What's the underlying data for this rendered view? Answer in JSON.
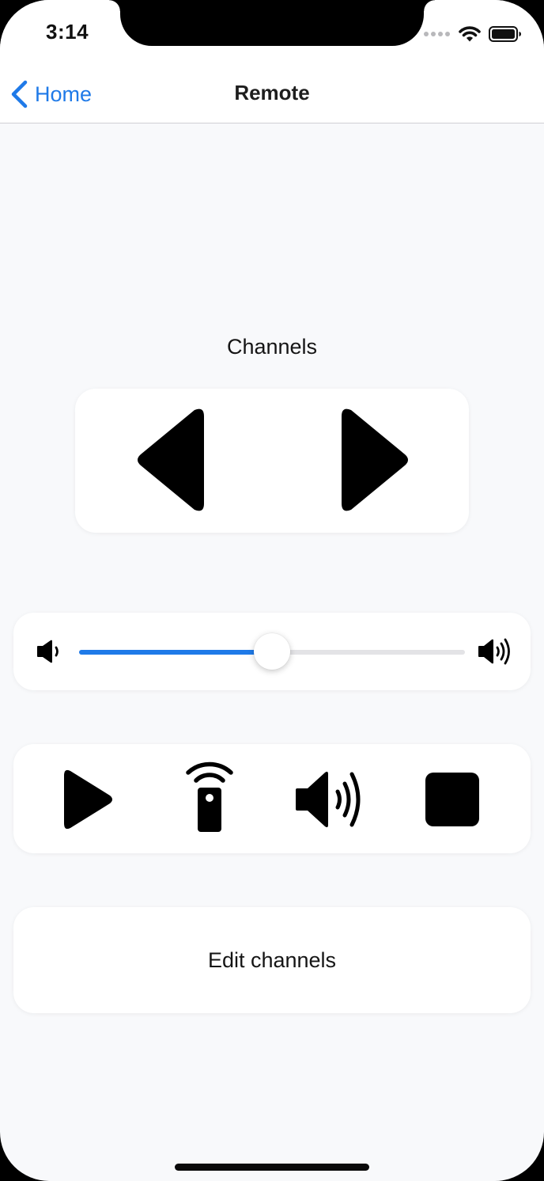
{
  "status_bar": {
    "time": "3:14",
    "icons": [
      "signal-icon",
      "wifi-icon",
      "battery-icon"
    ]
  },
  "nav": {
    "back_label": "Home",
    "title": "Remote",
    "accent_color": "#1f7ae8"
  },
  "channels": {
    "label": "Channels",
    "buttons": [
      "previous-channel-icon",
      "next-channel-icon"
    ]
  },
  "volume": {
    "value": 0.5,
    "min_icon": "speaker-low-icon",
    "max_icon": "speaker-high-icon"
  },
  "controls": {
    "buttons": [
      "play-icon",
      "remote-icon",
      "volume-icon",
      "stop-icon"
    ]
  },
  "edit_channels": {
    "label": "Edit channels"
  }
}
